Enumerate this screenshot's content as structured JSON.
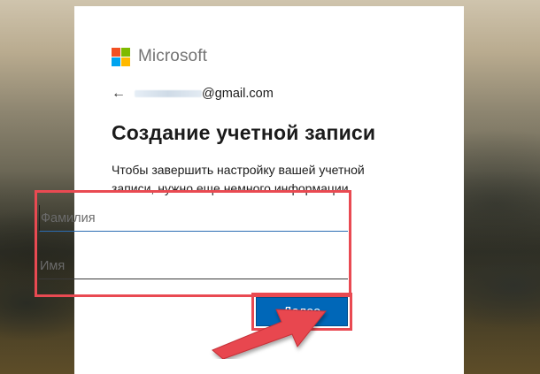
{
  "background": {
    "description_colors": [
      "#cfc4ad",
      "#5f5c4c",
      "#6f5d33"
    ]
  },
  "logo": {
    "text": "Microsoft",
    "squares": [
      "#f25022",
      "#7fba00",
      "#00a4ef",
      "#ffb900"
    ]
  },
  "account": {
    "back_icon": "back-arrow-icon",
    "email_domain": "@gmail.com"
  },
  "title": "Создание учетной записи",
  "description": "Чтобы завершить настройку вашей учетной записи, нужно еще немного информации.",
  "form": {
    "last_name_placeholder": "Фамилия",
    "first_name_placeholder": "Имя",
    "last_name_value": "",
    "first_name_value": ""
  },
  "next_button": {
    "label": "Далее",
    "color": "#0067b8"
  },
  "annotations": {
    "highlight_color": "#e94a52",
    "arrow_icon": "red-arrow-icon"
  }
}
